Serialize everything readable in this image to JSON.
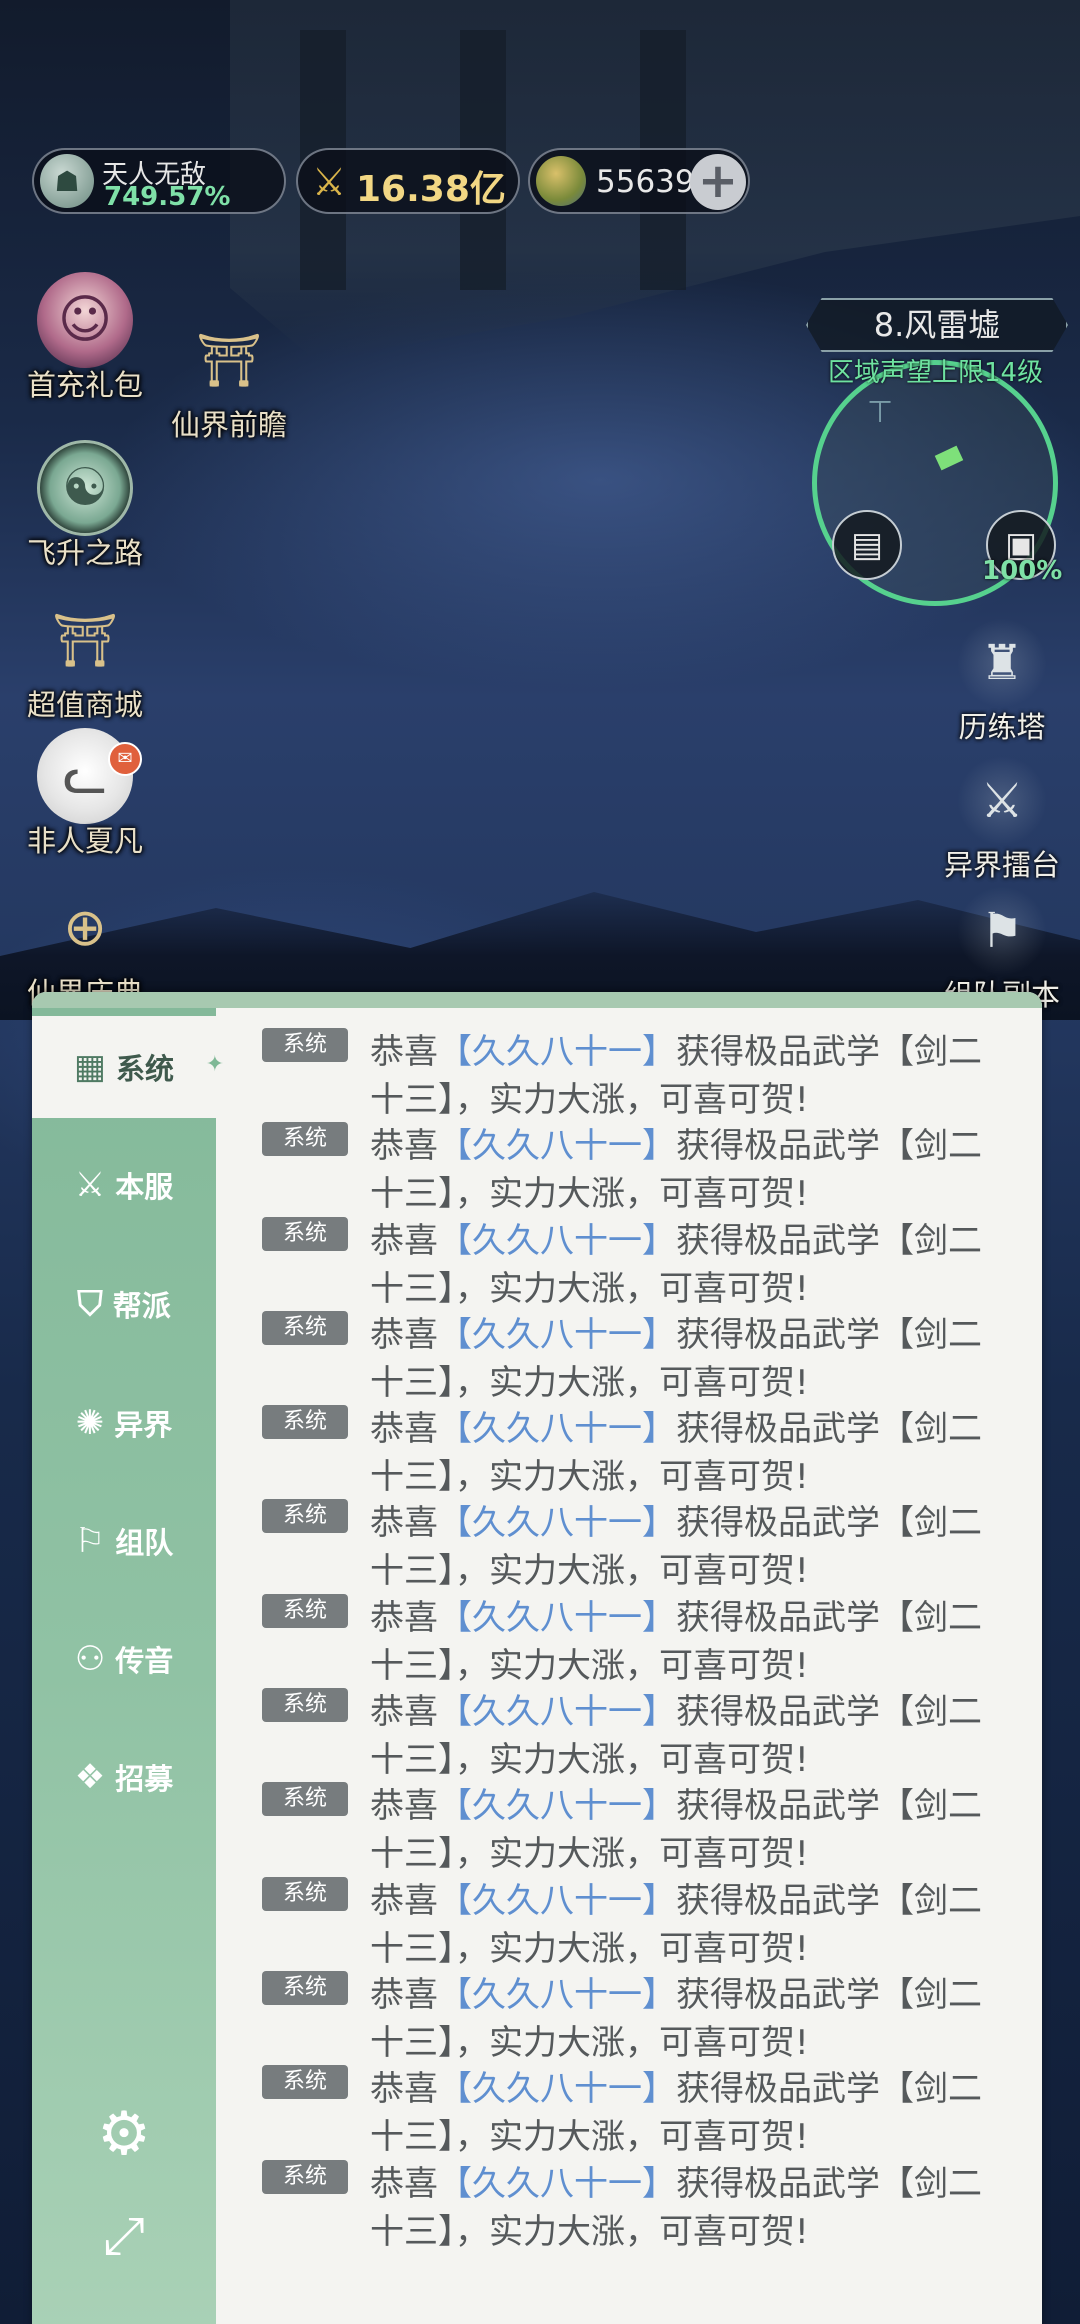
{
  "hud": {
    "title": {
      "name": "天人无敌",
      "percent": "749.57%"
    },
    "power": "16.38亿",
    "gold": "55639",
    "add_symbol": "+"
  },
  "left_icons": [
    {
      "label": "首充礼包",
      "icon": "gift-avatar-icon"
    },
    {
      "label": "仙界前瞻",
      "icon": "gate-icon"
    },
    {
      "label": "飞升之路",
      "icon": "ascension-icon"
    },
    {
      "label": "超值商城",
      "icon": "shop-icon"
    },
    {
      "label": "非人夏凡",
      "icon": "cat-avatar-icon"
    },
    {
      "label": "仙界庆典",
      "icon": "celebration-icon"
    }
  ],
  "map": {
    "title": "8.风雷墟",
    "subtitle": "区域声望上限14级",
    "percent": "100%"
  },
  "right_icons": [
    {
      "label": "历练塔",
      "icon": "tower-icon"
    },
    {
      "label": "异界擂台",
      "icon": "arena-icon"
    },
    {
      "label": "组队副本",
      "icon": "team-dungeon-icon"
    }
  ],
  "chat": {
    "tabs": [
      {
        "label": "系统",
        "icon": "grid-icon",
        "active": true
      },
      {
        "label": "本服",
        "icon": "crossed-swords-icon"
      },
      {
        "label": "帮派",
        "icon": "banner-icon"
      },
      {
        "label": "异界",
        "icon": "portal-icon"
      },
      {
        "label": "组队",
        "icon": "flag-icon"
      },
      {
        "label": "传音",
        "icon": "people-icon"
      },
      {
        "label": "招募",
        "icon": "cards-icon"
      }
    ],
    "tools": [
      {
        "name": "settings",
        "icon": "gear-icon"
      },
      {
        "name": "popout",
        "icon": "expand-icon"
      }
    ],
    "messages": [
      {
        "tag": "系统",
        "prefix": "恭喜",
        "player": "【久久八十一】",
        "suffix": "获得极品武学【剑二",
        "line2": "十三】，实力大涨，可喜可贺!"
      },
      {
        "tag": "系统",
        "prefix": "恭喜",
        "player": "【久久八十一】",
        "suffix": "获得极品武学【剑二",
        "line2": "十三】，实力大涨，可喜可贺!"
      },
      {
        "tag": "系统",
        "prefix": "恭喜",
        "player": "【久久八十一】",
        "suffix": "获得极品武学【剑二",
        "line2": "十三】，实力大涨，可喜可贺!"
      },
      {
        "tag": "系统",
        "prefix": "恭喜",
        "player": "【久久八十一】",
        "suffix": "获得极品武学【剑二",
        "line2": "十三】，实力大涨，可喜可贺!"
      },
      {
        "tag": "系统",
        "prefix": "恭喜",
        "player": "【久久八十一】",
        "suffix": "获得极品武学【剑二",
        "line2": "十三】，实力大涨，可喜可贺!"
      },
      {
        "tag": "系统",
        "prefix": "恭喜",
        "player": "【久久八十一】",
        "suffix": "获得极品武学【剑二",
        "line2": "十三】，实力大涨，可喜可贺!"
      },
      {
        "tag": "系统",
        "prefix": "恭喜",
        "player": "【久久八十一】",
        "suffix": "获得极品武学【剑二",
        "line2": "十三】，实力大涨，可喜可贺!"
      },
      {
        "tag": "系统",
        "prefix": "恭喜",
        "player": "【久久八十一】",
        "suffix": "获得极品武学【剑二",
        "line2": "十三】，实力大涨，可喜可贺!"
      },
      {
        "tag": "系统",
        "prefix": "恭喜",
        "player": "【久久八十一】",
        "suffix": "获得极品武学【剑二",
        "line2": "十三】，实力大涨，可喜可贺!"
      },
      {
        "tag": "系统",
        "prefix": "恭喜",
        "player": "【久久八十一】",
        "suffix": "获得极品武学【剑二",
        "line2": "十三】，实力大涨，可喜可贺!"
      },
      {
        "tag": "系统",
        "prefix": "恭喜",
        "player": "【久久八十一】",
        "suffix": "获得极品武学【剑二",
        "line2": "十三】，实力大涨，可喜可贺!"
      },
      {
        "tag": "系统",
        "prefix": "恭喜",
        "player": "【久久八十一】",
        "suffix": "获得极品武学【剑二",
        "line2": "十三】，实力大涨，可喜可贺!"
      },
      {
        "tag": "系统",
        "prefix": "恭喜",
        "player": "【久久八十一】",
        "suffix": "获得极品武学【剑二",
        "line2": "十三】，实力大涨，可喜可贺!"
      }
    ]
  },
  "colors": {
    "tab_green": "#84b99a",
    "panel_bg": "#f4f4f1",
    "player_blue": "#5f8fd0",
    "tag_gray": "#777c7e",
    "power_gold": "#f2d784",
    "percent_green": "#7fe0a8"
  }
}
